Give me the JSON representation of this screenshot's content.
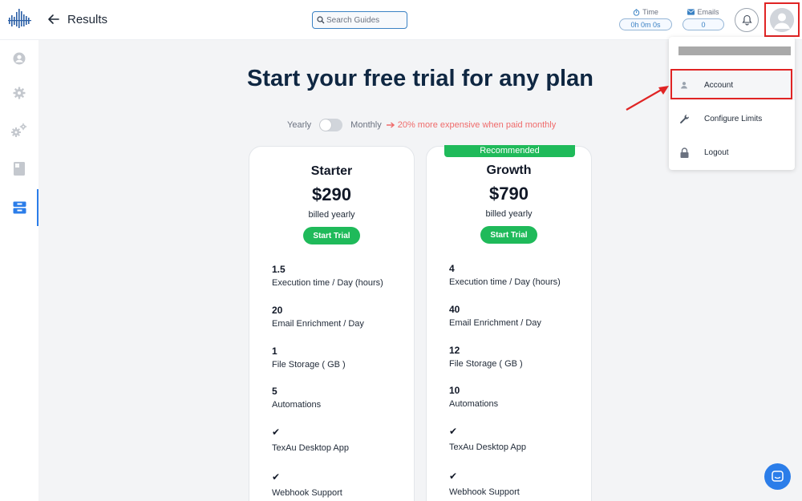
{
  "header": {
    "back_label": "back",
    "title": "Results",
    "search": {
      "placeholder": "Search Guides",
      "value": ""
    },
    "time": {
      "label": "Time",
      "value": "0h 0m 0s"
    },
    "emails": {
      "label": "Emails",
      "value": "0"
    }
  },
  "sidebar": {
    "items": [
      {
        "icon": "user-circle-icon",
        "active": false
      },
      {
        "icon": "gear-icon",
        "active": false
      },
      {
        "icon": "gears-icon",
        "active": false
      },
      {
        "icon": "book-icon",
        "active": false
      },
      {
        "icon": "inbox-icon",
        "active": true
      }
    ]
  },
  "pricing": {
    "headline": "Start your free trial for any plan",
    "toggle": {
      "left_label": "Yearly",
      "right_label": "Monthly",
      "note": "20% more expensive when paid monthly",
      "selected": "Yearly"
    },
    "plans": [
      {
        "name": "Starter",
        "price": "$290",
        "billing": "billed yearly",
        "cta": "Start Trial",
        "features": [
          {
            "value": "1.5",
            "label": "Execution time / Day (hours)"
          },
          {
            "value": "20",
            "label": "Email Enrichment / Day"
          },
          {
            "value": "1",
            "label": "File Storage ( GB )"
          },
          {
            "value": "5",
            "label": "Automations"
          },
          {
            "value": "✔",
            "label": "TexAu Desktop App"
          },
          {
            "value": "✔",
            "label": "Webhook Support"
          }
        ]
      },
      {
        "name": "Growth",
        "badge": "Recommended",
        "price": "$790",
        "billing": "billed yearly",
        "cta": "Start Trial",
        "features": [
          {
            "value": "4",
            "label": "Execution time / Day (hours)"
          },
          {
            "value": "40",
            "label": "Email Enrichment / Day"
          },
          {
            "value": "12",
            "label": "File Storage ( GB )"
          },
          {
            "value": "10",
            "label": "Automations"
          },
          {
            "value": "✔",
            "label": "TexAu Desktop App"
          },
          {
            "value": "✔",
            "label": "Webhook Support"
          }
        ]
      }
    ]
  },
  "user_menu": {
    "items": [
      {
        "label": "Account",
        "icon": "person-icon"
      },
      {
        "label": "Configure Limits",
        "icon": "wrench-icon"
      },
      {
        "label": "Logout",
        "icon": "lock-icon"
      }
    ]
  },
  "colors": {
    "accent": "#2b7de9",
    "green": "#1fba5a",
    "highlight": "#e02424",
    "headline": "#0f2742",
    "note": "#ef6b6b"
  }
}
